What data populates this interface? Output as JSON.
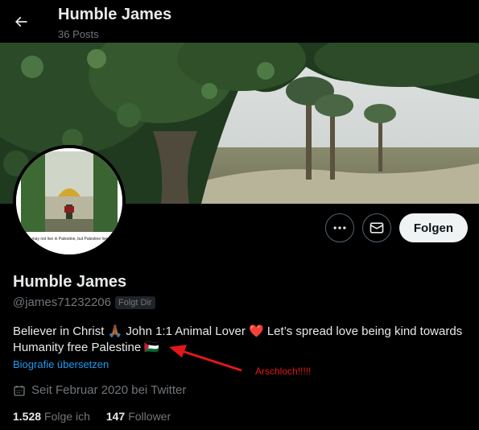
{
  "header": {
    "title": "Humble James",
    "post_count": "36 Posts"
  },
  "avatar": {
    "caption": "may not live in Palestine, but Palestine lives"
  },
  "actions": {
    "more_icon": "more-horizontal-icon",
    "message_icon": "mail-icon",
    "follow_label": "Folgen"
  },
  "profile": {
    "display_name": "Humble James",
    "handle": "@james71232206",
    "follows_you_badge": "Folgt Dir",
    "bio_line1": "Believer in Christ 🙏🏾 John 1:1 Animal Lover ❤️ Let’s spread love being kind towards",
    "bio_line2": "Humanity free Palestine 🇵🇸",
    "translate_bio": "Biografie übersetzen",
    "joined": "Seit Februar 2020 bei Twitter"
  },
  "stats": {
    "following_count": "1.528",
    "following_label": "Folge ich",
    "followers_count": "147",
    "followers_label": "Follower"
  },
  "annotation": {
    "text": "Arschloch!!!!!",
    "color": "#e0181a"
  },
  "colors": {
    "background": "#000000",
    "text_primary": "#e7e9ea",
    "text_secondary": "#71767b",
    "link": "#1d9bf0"
  }
}
